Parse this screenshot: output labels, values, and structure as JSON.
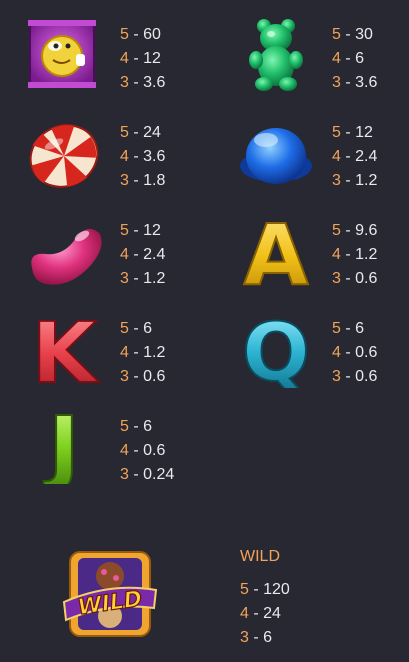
{
  "symbols": [
    {
      "name": "candy-bag",
      "pays": [
        {
          "count": "5",
          "value": "60"
        },
        {
          "count": "4",
          "value": "12"
        },
        {
          "count": "3",
          "value": "3.6"
        }
      ]
    },
    {
      "name": "gummy-bear",
      "pays": [
        {
          "count": "5",
          "value": "30"
        },
        {
          "count": "4",
          "value": "6"
        },
        {
          "count": "3",
          "value": "3.6"
        }
      ]
    },
    {
      "name": "peppermint-candy",
      "pays": [
        {
          "count": "5",
          "value": "24"
        },
        {
          "count": "4",
          "value": "3.6"
        },
        {
          "count": "3",
          "value": "1.8"
        }
      ]
    },
    {
      "name": "blue-candy",
      "pays": [
        {
          "count": "5",
          "value": "12"
        },
        {
          "count": "4",
          "value": "2.4"
        },
        {
          "count": "3",
          "value": "1.2"
        }
      ]
    },
    {
      "name": "jelly-bean",
      "pays": [
        {
          "count": "5",
          "value": "12"
        },
        {
          "count": "4",
          "value": "2.4"
        },
        {
          "count": "3",
          "value": "1.2"
        }
      ]
    },
    {
      "name": "letter-a",
      "glyph": "A",
      "pays": [
        {
          "count": "5",
          "value": "9.6"
        },
        {
          "count": "4",
          "value": "1.2"
        },
        {
          "count": "3",
          "value": "0.6"
        }
      ]
    },
    {
      "name": "letter-k",
      "glyph": "K",
      "pays": [
        {
          "count": "5",
          "value": "6"
        },
        {
          "count": "4",
          "value": "1.2"
        },
        {
          "count": "3",
          "value": "0.6"
        }
      ]
    },
    {
      "name": "letter-q",
      "glyph": "Q",
      "pays": [
        {
          "count": "5",
          "value": "6"
        },
        {
          "count": "4",
          "value": "0.6"
        },
        {
          "count": "3",
          "value": "0.6"
        }
      ]
    },
    {
      "name": "letter-j",
      "glyph": "J",
      "pays": [
        {
          "count": "5",
          "value": "6"
        },
        {
          "count": "4",
          "value": "0.6"
        },
        {
          "count": "3",
          "value": "0.24"
        }
      ]
    }
  ],
  "wild": {
    "title": "WILD",
    "badge_text": "WILD",
    "pays": [
      {
        "count": "5",
        "value": "120"
      },
      {
        "count": "4",
        "value": "24"
      },
      {
        "count": "3",
        "value": "6"
      }
    ]
  },
  "colors": {
    "background": "#272831",
    "count": "#f2a35a",
    "value": "#e9e9ee"
  }
}
